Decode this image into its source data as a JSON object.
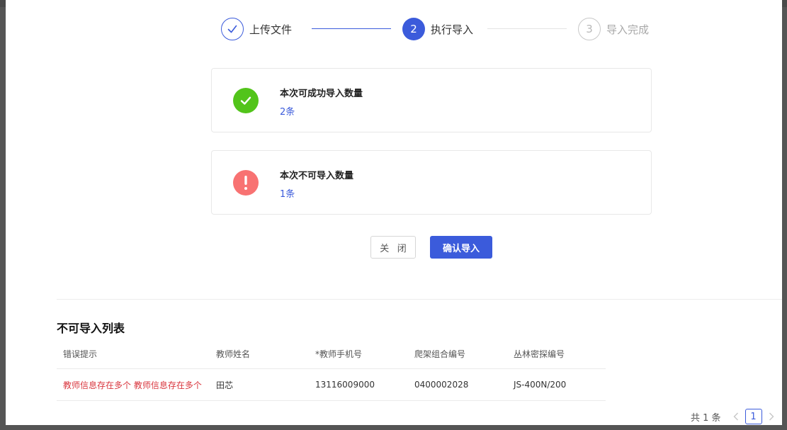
{
  "steps": [
    {
      "index": "1",
      "label": "上传文件",
      "state": "done"
    },
    {
      "index": "2",
      "label": "执行导入",
      "state": "active"
    },
    {
      "index": "3",
      "label": "导入完成",
      "state": "wait"
    }
  ],
  "results": {
    "success": {
      "title": "本次可成功导入数量",
      "count": "2条",
      "icon": "check-circle-icon",
      "color": "#52c41a"
    },
    "fail": {
      "title": "本次不可导入数量",
      "count": "1条",
      "icon": "exclamation-circle-icon",
      "color": "#f87272"
    }
  },
  "actions": {
    "close_label": "关 闭",
    "confirm_label": "确认导入"
  },
  "list": {
    "title": "不可导入列表",
    "columns": [
      "错误提示",
      "教师姓名",
      "*教师手机号",
      "爬架组合编号",
      "丛林密探编号"
    ],
    "rows": [
      [
        "教师信息存在多个 教师信息存在多个",
        "田芯",
        "13116009000",
        "0400002028",
        "JS-400N/200"
      ]
    ]
  },
  "pagination": {
    "total_text": "共 1 条",
    "current_page": "1"
  },
  "colors": {
    "primary": "#3b5bdb",
    "error_text": "#d9363e"
  }
}
